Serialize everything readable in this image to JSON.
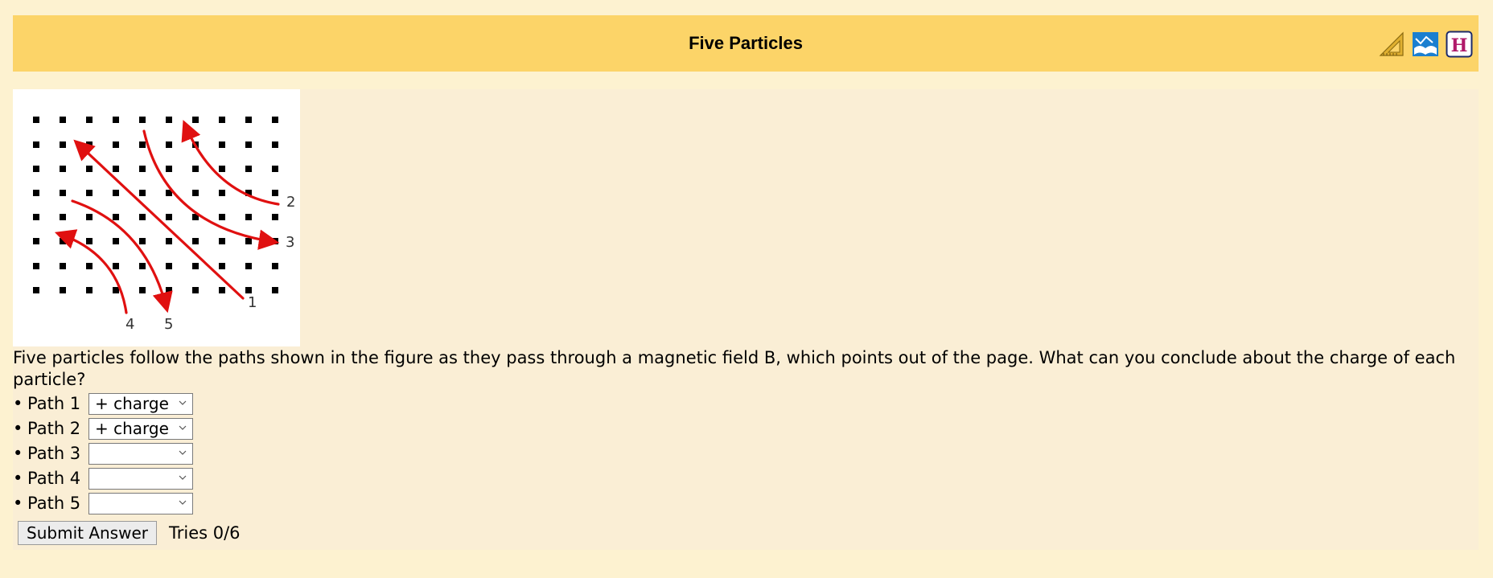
{
  "header": {
    "title": "Five Particles",
    "icons": [
      "ruler-triangle-icon",
      "book-icon",
      "help-h-icon"
    ]
  },
  "figure": {
    "labels": [
      "1",
      "2",
      "3",
      "4",
      "5"
    ],
    "dot_color": "#000000",
    "path_color": "#e01010"
  },
  "question": {
    "text": "Five particles follow the paths shown in the figure as they pass through a magnetic field B, which points out of the page. What can you conclude about the charge of each particle?"
  },
  "paths": [
    {
      "label": "Path 1",
      "value": "+ charge"
    },
    {
      "label": "Path 2",
      "value": "+ charge"
    },
    {
      "label": "Path 3",
      "value": ""
    },
    {
      "label": "Path 4",
      "value": ""
    },
    {
      "label": "Path 5",
      "value": ""
    }
  ],
  "bullet": "•",
  "submit_label": "Submit Answer",
  "tries": "Tries 0/6"
}
